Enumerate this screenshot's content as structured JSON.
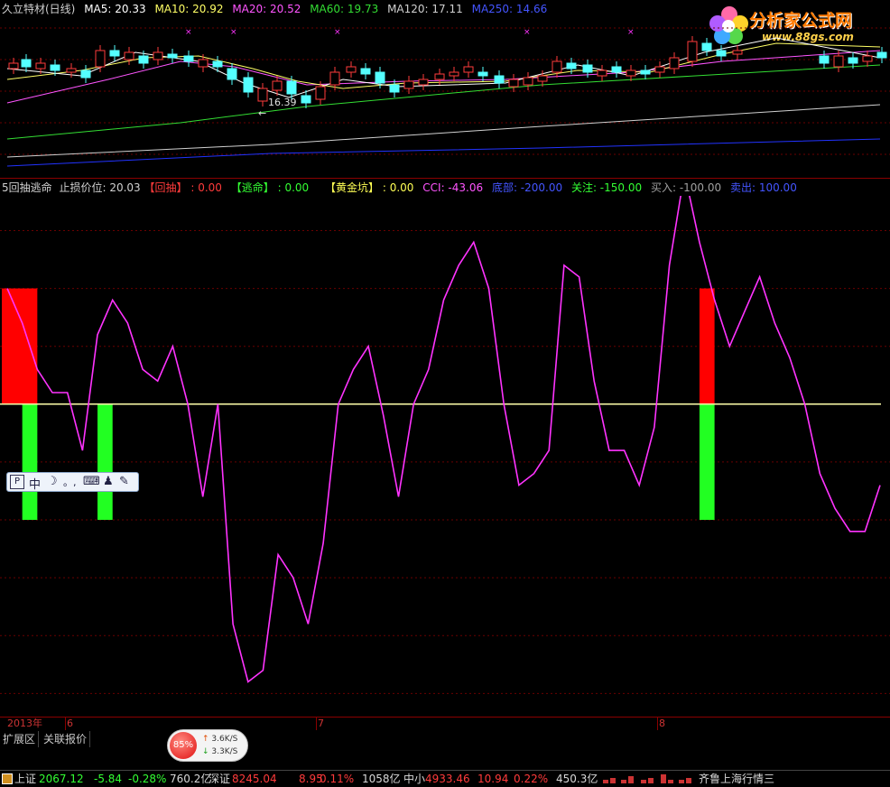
{
  "main_chart": {
    "legend": {
      "stock": "久立特材(日线)",
      "ma5": "MA5: 20.33",
      "ma10": "MA10: 20.92",
      "ma20": "MA20: 20.52",
      "ma60": "MA60: 19.73",
      "ma120": "MA120: 17.11",
      "ma250": "MA250: 14.66"
    },
    "low_marker_label": "16.39",
    "colors": {
      "up_candle": "#ff3b3b",
      "down_candle": "#54ffff",
      "ma5": "#ffffff",
      "ma10": "#ffff66",
      "ma20": "#ff55ff",
      "ma60": "#33dd33",
      "ma120": "#d0d0d0",
      "ma250": "#2233ff"
    }
  },
  "indicator": {
    "legend": {
      "name": "5回抽逃命",
      "stop_loss": "止损价位: 20.03",
      "huichou_tag": "【回抽】",
      "huichou_val": ": 0.00",
      "taoming_tag": "【逃命】",
      "taoming_val": ": 0.00",
      "huangjinkeng_tag": "【黄金坑】",
      "huangjinkeng_val": ": 0.00",
      "cci": "CCI: -43.06",
      "dibu": "底部: -200.00",
      "guanzhu": "关注: -150.00",
      "mairu": "买入: -100.00",
      "maichu": "卖出: 100.00"
    },
    "colors": {
      "cci_line": "#ff33ff",
      "zero_line": "#ffffaa",
      "red_block": "#ff0000",
      "green_block": "#22ff22"
    }
  },
  "chart_data": {
    "type": "line",
    "title": "",
    "series": [
      {
        "name": "CCI",
        "values": [
          100,
          70,
          30,
          10,
          10,
          -40,
          60,
          90,
          70,
          30,
          20,
          50,
          0,
          -80,
          0,
          -190,
          -240,
          -230,
          -130,
          -150,
          -190,
          -120,
          0,
          30,
          50,
          -10,
          -80,
          0,
          30,
          90,
          120,
          140,
          100,
          0,
          -70,
          -60,
          -40,
          120,
          110,
          20,
          -40,
          -40,
          -70,
          -20,
          120,
          200,
          140,
          90,
          50,
          80,
          110,
          70,
          40,
          0,
          -60,
          -90,
          -110,
          -110,
          -70
        ]
      }
    ],
    "ylim": [
      -270,
      180
    ],
    "reference_lines": [
      0
    ],
    "signal_blocks": [
      {
        "index_start": 0,
        "index_end": 2,
        "color": "red",
        "from": 0,
        "to": 100
      },
      {
        "index_start": 1,
        "index_end": 2,
        "color": "green",
        "from": -100,
        "to": 0
      },
      {
        "index_start": 6,
        "index_end": 7,
        "color": "green",
        "from": -100,
        "to": 0
      },
      {
        "index_start": 46,
        "index_end": 47,
        "color": "red",
        "from": 0,
        "to": 100
      },
      {
        "index_start": 46,
        "index_end": 47,
        "color": "green",
        "from": -100,
        "to": 0
      }
    ]
  },
  "time_axis": {
    "year": "2013年",
    "months": [
      "6",
      "7",
      "8"
    ]
  },
  "tabs": [
    "扩展区",
    "关联报价"
  ],
  "status_bar": {
    "sh_label": "上证",
    "sh_value": "2067.12",
    "sh_change": "-5.84",
    "sh_pct": "-0.28%",
    "sh_amount": "760.2亿",
    "sz_label": "深证",
    "sz_value": "8245.04",
    "sz_change": "8.95",
    "sz_pct": "0.11%",
    "sz_amount": "1058亿",
    "zx_label": "中小",
    "zx_value": "4933.46",
    "zx_change": "10.94",
    "zx_pct": "0.22%",
    "zx_amount": "450.3亿",
    "feed": "齐鲁上海行情三"
  },
  "logo": {
    "text": "分析家公式网",
    "url": "www.88gs.com"
  },
  "ime": {
    "mode": "中",
    "punct": "。,"
  },
  "speed": {
    "percent": "85%",
    "up": "3.6K/S",
    "down": "3.3K/S"
  }
}
